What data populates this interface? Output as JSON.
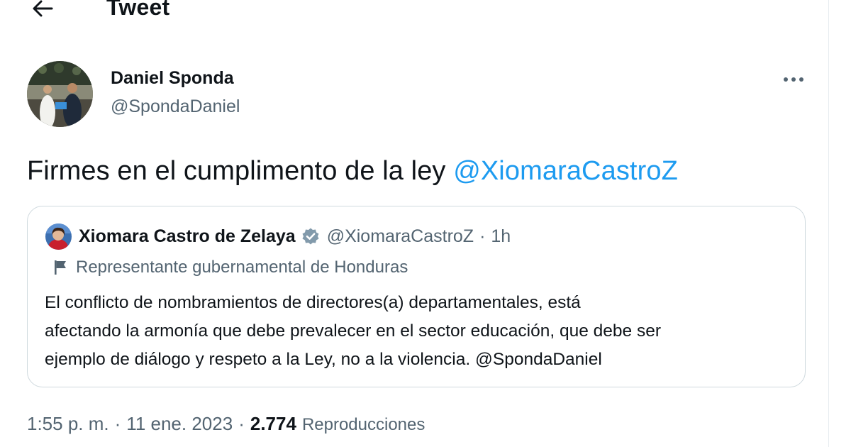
{
  "header": {
    "title": "Tweet",
    "back_icon": "arrow-left-icon"
  },
  "author": {
    "name": "Daniel Sponda",
    "handle": "@SpondaDaniel",
    "more_icon": "more-horizontal-icon"
  },
  "tweet": {
    "text": "Firmes en el cumplimento de la ley ",
    "mention": "@XiomaraCastroZ"
  },
  "quoted": {
    "name": "Xiomara Castro de Zelaya",
    "verified_icon": "verified-badge-icon",
    "handle": "@XiomaraCastroZ",
    "separator": "·",
    "time": "1h",
    "label_icon": "flag-icon",
    "label": "Representante gubernamental de Honduras",
    "lines": [
      "El conflicto de nombramientos de directores(a) departamentales, está",
      "afectando la armonía que debe prevalecer en el sector educación, que debe ser",
      "ejemplo de diálogo y respeto a la Ley, no a la violencia. @SpondaDaniel"
    ]
  },
  "meta": {
    "time": "1:55 p. m.",
    "separator": "·",
    "date": "11 ene. 2023",
    "views_count": "2.774",
    "views_label": "Reproducciones"
  },
  "colors": {
    "text": "#0f1419",
    "secondary": "#536471",
    "link": "#1d9bf0",
    "border": "#cfd9de",
    "verified": "#829aab"
  }
}
